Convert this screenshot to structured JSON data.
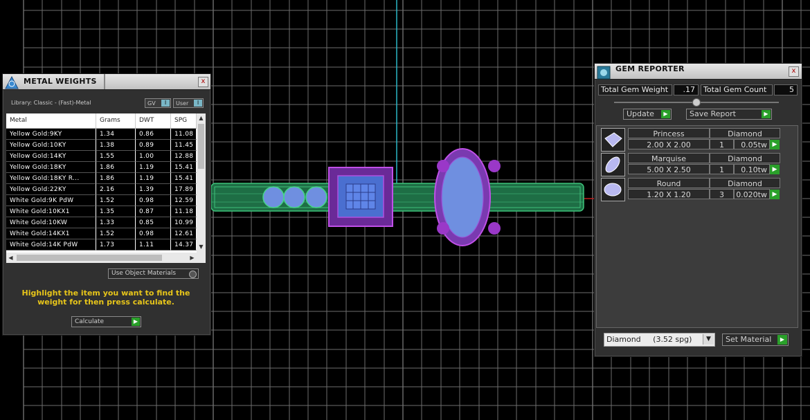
{
  "metal_weights": {
    "title": "METAL WEIGHTS",
    "library_label": "Library: Classic - (Fast)-Metal",
    "toggle_gv": "GV",
    "toggle_user": "User",
    "toggle_mark": "I",
    "columns": [
      "Metal",
      "Grams",
      "DWT",
      "SPG"
    ],
    "rows": [
      [
        "Yellow Gold:9KY",
        "1.34",
        "0.86",
        "11.08"
      ],
      [
        "Yellow Gold:10KY",
        "1.38",
        "0.89",
        "11.45"
      ],
      [
        "Yellow Gold:14KY",
        "1.55",
        "1.00",
        "12.88"
      ],
      [
        "Yellow Gold:18KY",
        "1.86",
        "1.19",
        "15.41"
      ],
      [
        "Yellow Gold:18KY R...",
        "1.86",
        "1.19",
        "15.41"
      ],
      [
        "Yellow Gold:22KY",
        "2.16",
        "1.39",
        "17.89"
      ],
      [
        "White Gold:9K PdW",
        "1.52",
        "0.98",
        "12.59"
      ],
      [
        "White Gold:10KX1",
        "1.35",
        "0.87",
        "11.18"
      ],
      [
        "White Gold:10KW",
        "1.33",
        "0.85",
        "10.99"
      ],
      [
        "White Gold:14KX1",
        "1.52",
        "0.98",
        "12.61"
      ],
      [
        "White Gold:14K PdW",
        "1.73",
        "1.11",
        "14.37"
      ]
    ],
    "use_object_materials": "Use Object Materials",
    "hint": "Highlight the item you want to find the weight for then press calculate.",
    "calculate_label": "Calculate",
    "close": "x"
  },
  "gem_reporter": {
    "title": "GEM REPORTER",
    "total_gem_weight_label": "Total Gem Weight",
    "total_gem_weight": ".17",
    "total_gem_count_label": "Total Gem Count",
    "total_gem_count": "5",
    "update_label": "Update",
    "save_report_label": "Save Report",
    "gems": [
      {
        "shape": "Princess",
        "material": "Diamond",
        "size": "2.00 X 2.00",
        "count": "1",
        "weight": "0.05tw",
        "icon": "princess-gem-icon"
      },
      {
        "shape": "Marquise",
        "material": "Diamond",
        "size": "5.00 X 2.50",
        "count": "1",
        "weight": "0.10tw",
        "icon": "marquise-gem-icon"
      },
      {
        "shape": "Round",
        "material": "Diamond",
        "size": "1.20 X 1.20",
        "count": "3",
        "weight": "0.020tw",
        "icon": "round-gem-icon"
      }
    ],
    "material_select": "Diamond     (3.52 spg)",
    "set_material_label": "Set Material",
    "close": "x"
  },
  "colors": {
    "viewport_bg": "#000000",
    "grid_line": "#8a8a8a",
    "ring_band": "#2e8f55",
    "setting_purple": "#9a38c8",
    "gem_blue": "#6f8fe0",
    "axis_cyan": "#2bb7c8",
    "hint_yellow": "#e7c51a",
    "accent_green": "#2aa02a"
  }
}
